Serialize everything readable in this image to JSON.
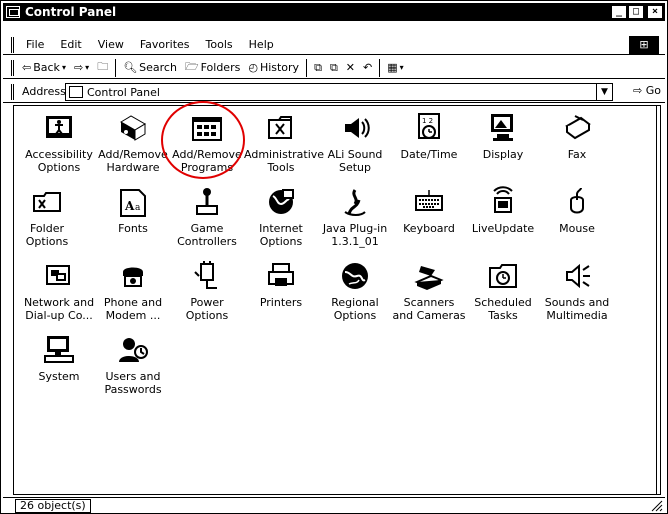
{
  "window": {
    "title": "Control Panel",
    "minimize": "_",
    "maximize": "□",
    "close": "×"
  },
  "menubar": {
    "items": [
      {
        "label": "File"
      },
      {
        "label": "Edit"
      },
      {
        "label": "View"
      },
      {
        "label": "Favorites"
      },
      {
        "label": "Tools"
      },
      {
        "label": "Help"
      }
    ]
  },
  "toolbar": {
    "back": "Back",
    "search": "Search",
    "folders": "Folders",
    "history": "History"
  },
  "address": {
    "label": "Address",
    "value": "Control Panel",
    "go": "Go"
  },
  "items": [
    {
      "label": "Accessibility Options",
      "icon": "accessibility-icon"
    },
    {
      "label": "Add/Remove Hardware",
      "icon": "hardware-icon"
    },
    {
      "label": "Add/Remove Programs",
      "icon": "programs-icon"
    },
    {
      "label": "Administrative Tools",
      "icon": "admin-tools-icon"
    },
    {
      "label": "ALi Sound Setup",
      "icon": "speaker-icon"
    },
    {
      "label": "Date/Time",
      "icon": "calendar-clock-icon"
    },
    {
      "label": "Display",
      "icon": "monitor-icon"
    },
    {
      "label": "Fax",
      "icon": "fax-icon"
    },
    {
      "label": "Folder Options",
      "icon": "folder-icon"
    },
    {
      "label": "Fonts",
      "icon": "fonts-icon"
    },
    {
      "label": "Game Controllers",
      "icon": "joystick-icon"
    },
    {
      "label": "Internet Options",
      "icon": "globe-icon"
    },
    {
      "label": "Java Plug-in 1.3.1_01",
      "icon": "java-icon"
    },
    {
      "label": "Keyboard",
      "icon": "keyboard-icon"
    },
    {
      "label": "LiveUpdate",
      "icon": "liveupdate-icon"
    },
    {
      "label": "Mouse",
      "icon": "mouse-icon"
    },
    {
      "label": "Network and Dial-up Co...",
      "icon": "network-icon"
    },
    {
      "label": "Phone and Modem ...",
      "icon": "phone-icon"
    },
    {
      "label": "Power Options",
      "icon": "power-icon"
    },
    {
      "label": "Printers",
      "icon": "printer-icon"
    },
    {
      "label": "Regional Options",
      "icon": "globe-regional-icon"
    },
    {
      "label": "Scanners and Cameras",
      "icon": "scanner-icon"
    },
    {
      "label": "Scheduled Tasks",
      "icon": "scheduled-tasks-icon"
    },
    {
      "label": "Sounds and Multimedia",
      "icon": "sound-icon"
    },
    {
      "label": "System",
      "icon": "computer-icon"
    },
    {
      "label": "Users and Passwords",
      "icon": "users-icon"
    }
  ],
  "status": {
    "text": "26 object(s)"
  },
  "colors": {
    "highlight": "#e00000"
  }
}
